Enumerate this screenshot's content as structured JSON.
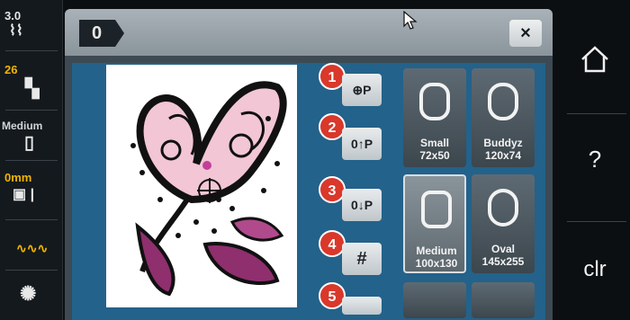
{
  "left_status": {
    "stitch_width": "3.0",
    "stitch_length": "26",
    "hoop_label": "Medium",
    "offset": "0mm"
  },
  "dialog": {
    "mode_symbol": "0",
    "close_label": "×"
  },
  "badges": [
    "1",
    "2",
    "3",
    "4",
    "5"
  ],
  "tools": [
    "⊕P",
    "0↑P",
    "0↓P",
    "#"
  ],
  "hoops": [
    {
      "name": "Small",
      "size": "72x50"
    },
    {
      "name": "Buddyz",
      "size": "120x74"
    },
    {
      "name": "Medium",
      "size": "100x130"
    },
    {
      "name": "Oval",
      "size": "145x255"
    }
  ],
  "right_nav": {
    "home_icon": "home-icon",
    "help_label": "?",
    "clear_label": "clr"
  },
  "colors": {
    "accent": "#d9382b",
    "panel_blue": "#23628a",
    "status_yellow": "#f0b400"
  }
}
